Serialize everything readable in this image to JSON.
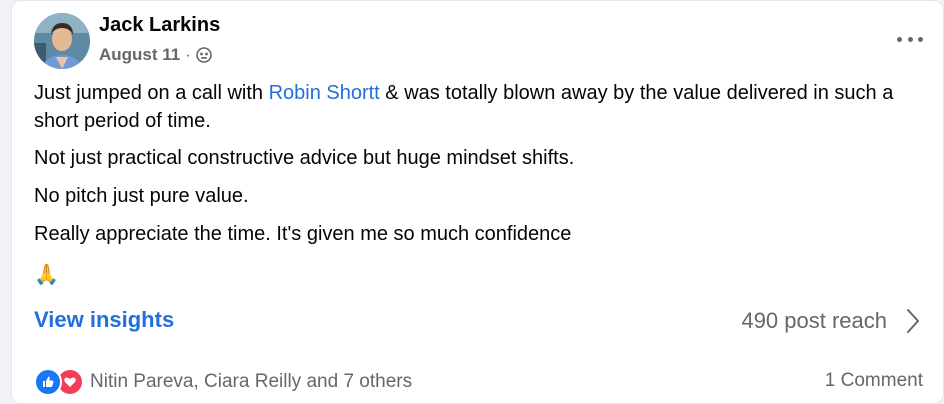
{
  "post": {
    "author": "Jack Larkins",
    "date": "August 11",
    "separator": "·",
    "audience_icon": "globe-icon",
    "more_icon": "more-options-icon",
    "body": {
      "line1_before": "Just jumped on a call with ",
      "mention": "Robin Shortt",
      "line1_after": " & was totally blown away by the value delivered in such a short period of time.",
      "line2": "Not just practical constructive advice but huge mindset shifts.",
      "line3": "No pitch just pure value.",
      "line4": "Really appreciate the time. It's given me so much confidence",
      "emoji": "🙏"
    },
    "insights_label": "View insights",
    "reach_label": "490 post reach",
    "reactions": {
      "icons": [
        "like-icon",
        "love-icon"
      ],
      "summary": "Nitin Pareva, Ciara Reilly and 7 others"
    },
    "comments_label": "1 Comment"
  },
  "colors": {
    "link": "#216fdb",
    "secondary_text": "#65676b",
    "like": "#1877f2",
    "love": "#f33e58"
  }
}
